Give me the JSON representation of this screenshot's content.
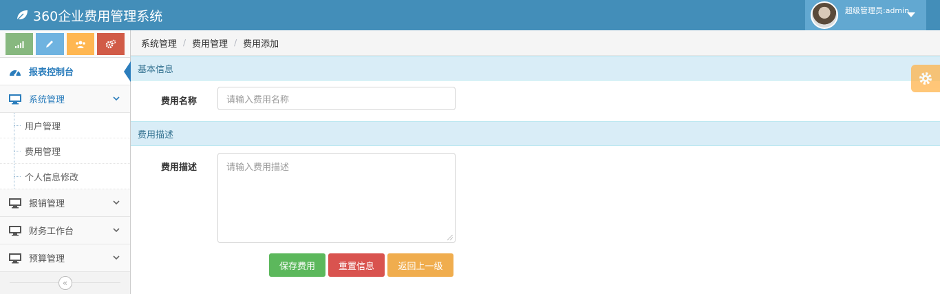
{
  "app": {
    "title": "360企业费用管理系统",
    "user_label": "超级管理员:admin"
  },
  "colors": {
    "navbar": "#438eb9",
    "user_area": "#62a8d1",
    "accent": "#2b7dbc",
    "success": "#5cb85c",
    "danger": "#d9534f",
    "warning": "#f0ad4e"
  },
  "shortcuts": [
    {
      "icon": "signal-icon",
      "color": "#87b87f"
    },
    {
      "icon": "pencil-icon",
      "color": "#6fb3e0"
    },
    {
      "icon": "users-icon",
      "color": "#ffb752"
    },
    {
      "icon": "cogs-icon",
      "color": "#d15b47"
    }
  ],
  "sidebar": {
    "dashboard": "报表控制台",
    "system": {
      "label": "系统管理",
      "items": [
        "用户管理",
        "费用管理",
        "个人信息修改"
      ]
    },
    "reimburse": "报销管理",
    "finance": "财务工作台",
    "budget": "预算管理",
    "collapse_icon": "double-angle-left-icon"
  },
  "breadcrumb": [
    "系统管理",
    "费用管理",
    "费用添加"
  ],
  "form": {
    "basic_section": "基本信息",
    "name_label": "费用名称",
    "name_placeholder": "请输入费用名称",
    "desc_section": "费用描述",
    "desc_label": "费用描述",
    "desc_placeholder": "请输入费用描述",
    "save": "保存费用",
    "reset": "重置信息",
    "back": "返回上一级"
  }
}
